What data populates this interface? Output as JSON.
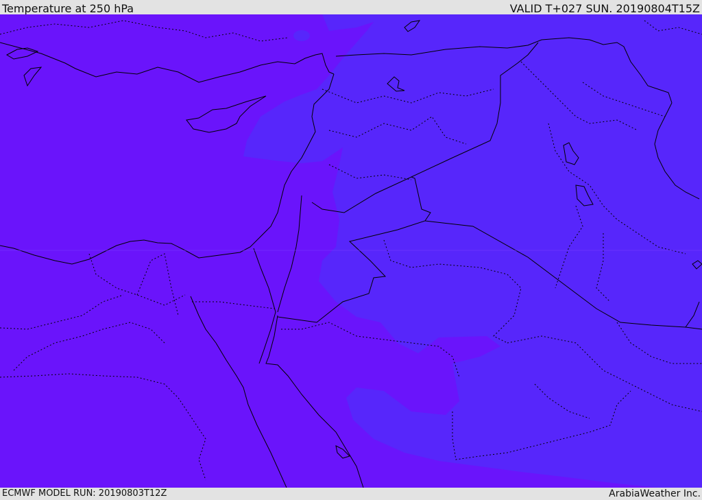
{
  "header": {
    "title": "Temperature at 250 hPa",
    "valid": "VALID T+027 SUN. 20190804T15Z"
  },
  "footer": {
    "model_run": "ECMWF MODEL RUN: 20190803T12Z",
    "credit": "ArabiaWeather Inc."
  },
  "colors": {
    "field_cold": "#6a14fb",
    "field_warm": "#5726fb",
    "borders": "#000000",
    "bars": "#e3e3e3"
  }
}
